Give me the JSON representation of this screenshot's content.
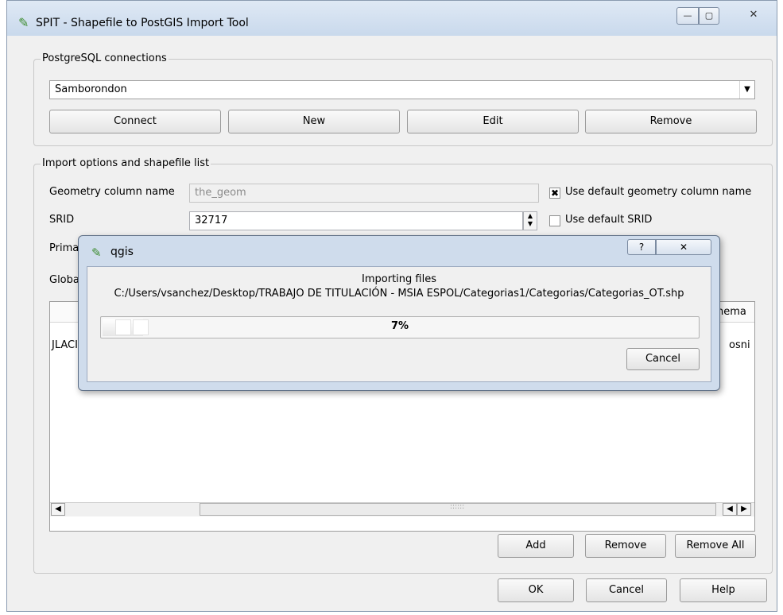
{
  "window": {
    "title": "SPIT - Shapefile to PostGIS Import Tool",
    "min_glyph": "—",
    "max_glyph": "▢",
    "close_glyph": "✕",
    "icon": "qgis-icon"
  },
  "connections": {
    "legend": "PostgreSQL connections",
    "selected": "Samborondon",
    "dropdown_glyph": "▼",
    "buttons": {
      "connect": "Connect",
      "new": "New",
      "edit": "Edit",
      "remove": "Remove"
    }
  },
  "import": {
    "legend": "Import options and shapefile list",
    "geom_label": "Geometry column name",
    "geom_value": "the_geom",
    "use_default_geom_label": "Use default geometry column name",
    "use_default_geom_checked": true,
    "check_glyph": "✖",
    "srid_label": "SRID",
    "srid_value": "32717",
    "use_default_srid_label": "Use default SRID",
    "use_default_srid_checked": false,
    "primary_label": "Primar",
    "global_label": "Globa",
    "table": {
      "left_cell": "JLACI",
      "right_header": "hema",
      "right_cell": "osni"
    },
    "scroll": {
      "left_glyph": "◀",
      "right_glyph": "▶",
      "grip": "::::::"
    },
    "buttons": {
      "add": "Add",
      "remove": "Remove",
      "remove_all": "Remove All"
    }
  },
  "footer": {
    "ok": "OK",
    "cancel": "Cancel",
    "help": "Help"
  },
  "dialog": {
    "title": "qgis",
    "help_glyph": "?",
    "close_glyph": "✕",
    "label": "Importing files",
    "path": "C:/Users/vsanchez/Desktop/TRABAJO DE TITULACIÓN - MSIA ESPOL/Categorias1/Categorias/Categorias_OT.shp",
    "progress_percent": 7,
    "progress_text": "7%",
    "cancel": "Cancel"
  },
  "colors": {
    "accent_green": "#3d8c2f",
    "dialog_frame": "#cfdcec"
  }
}
